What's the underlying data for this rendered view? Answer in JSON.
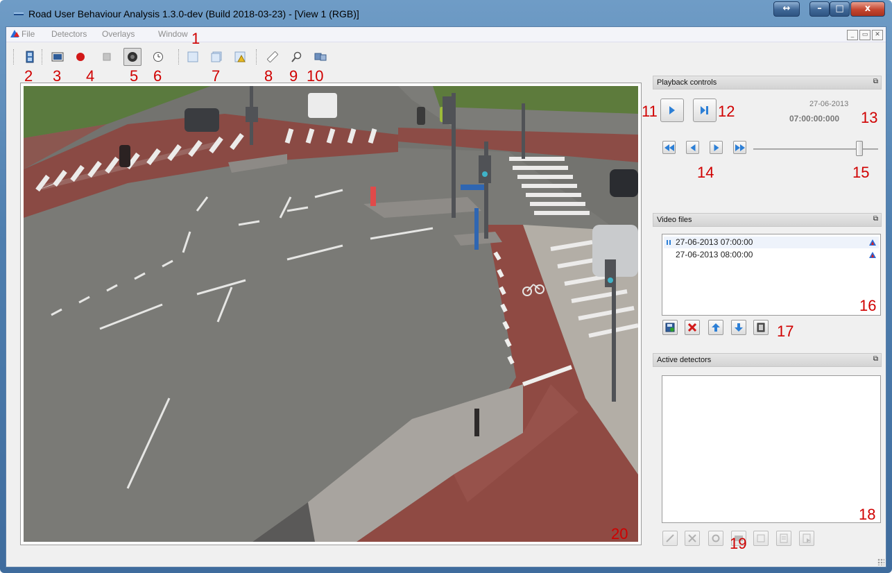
{
  "window": {
    "title": "Road User Behaviour Analysis 1.3.0-dev (Build 2018-03-23) - [View 1 (RGB)]",
    "buttons": {
      "resize": "↔",
      "minimize": "–",
      "maximize": "□",
      "close": "x"
    }
  },
  "menu": {
    "items": [
      "File",
      "Detectors",
      "Overlays",
      "Window"
    ],
    "mdi": {
      "minimize": "_",
      "restore": "▭",
      "close": "✕"
    }
  },
  "toolbar": {
    "icons": [
      "open-video-icon",
      "snapshot-icon",
      "record-icon",
      "stop-icon",
      "camera-view-icon",
      "timer-icon",
      "single-view-icon",
      "multi-view-icon",
      "warning-view-icon",
      "ruler-icon",
      "zoom-icon",
      "display-settings-icon"
    ]
  },
  "annotations": [
    "1",
    "2",
    "3",
    "4",
    "5",
    "6",
    "7",
    "8",
    "9",
    "10",
    "11",
    "12",
    "13",
    "14",
    "15",
    "16",
    "17",
    "18",
    "19",
    "20"
  ],
  "playback": {
    "header": "Playback controls",
    "date": "27-06-2013",
    "time": "07:00:00:000",
    "slider_position": 0.87
  },
  "video_files": {
    "header": "Video files",
    "files": [
      {
        "label": "27-06-2013 07:00:00",
        "playing": true
      },
      {
        "label": "27-06-2013 08:00:00",
        "playing": false
      }
    ]
  },
  "active_detectors": {
    "header": "Active detectors",
    "items": []
  },
  "colors": {
    "accent": "#2c7fd6",
    "annotation": "#d00000",
    "brick_lane": "#8f4a43"
  }
}
